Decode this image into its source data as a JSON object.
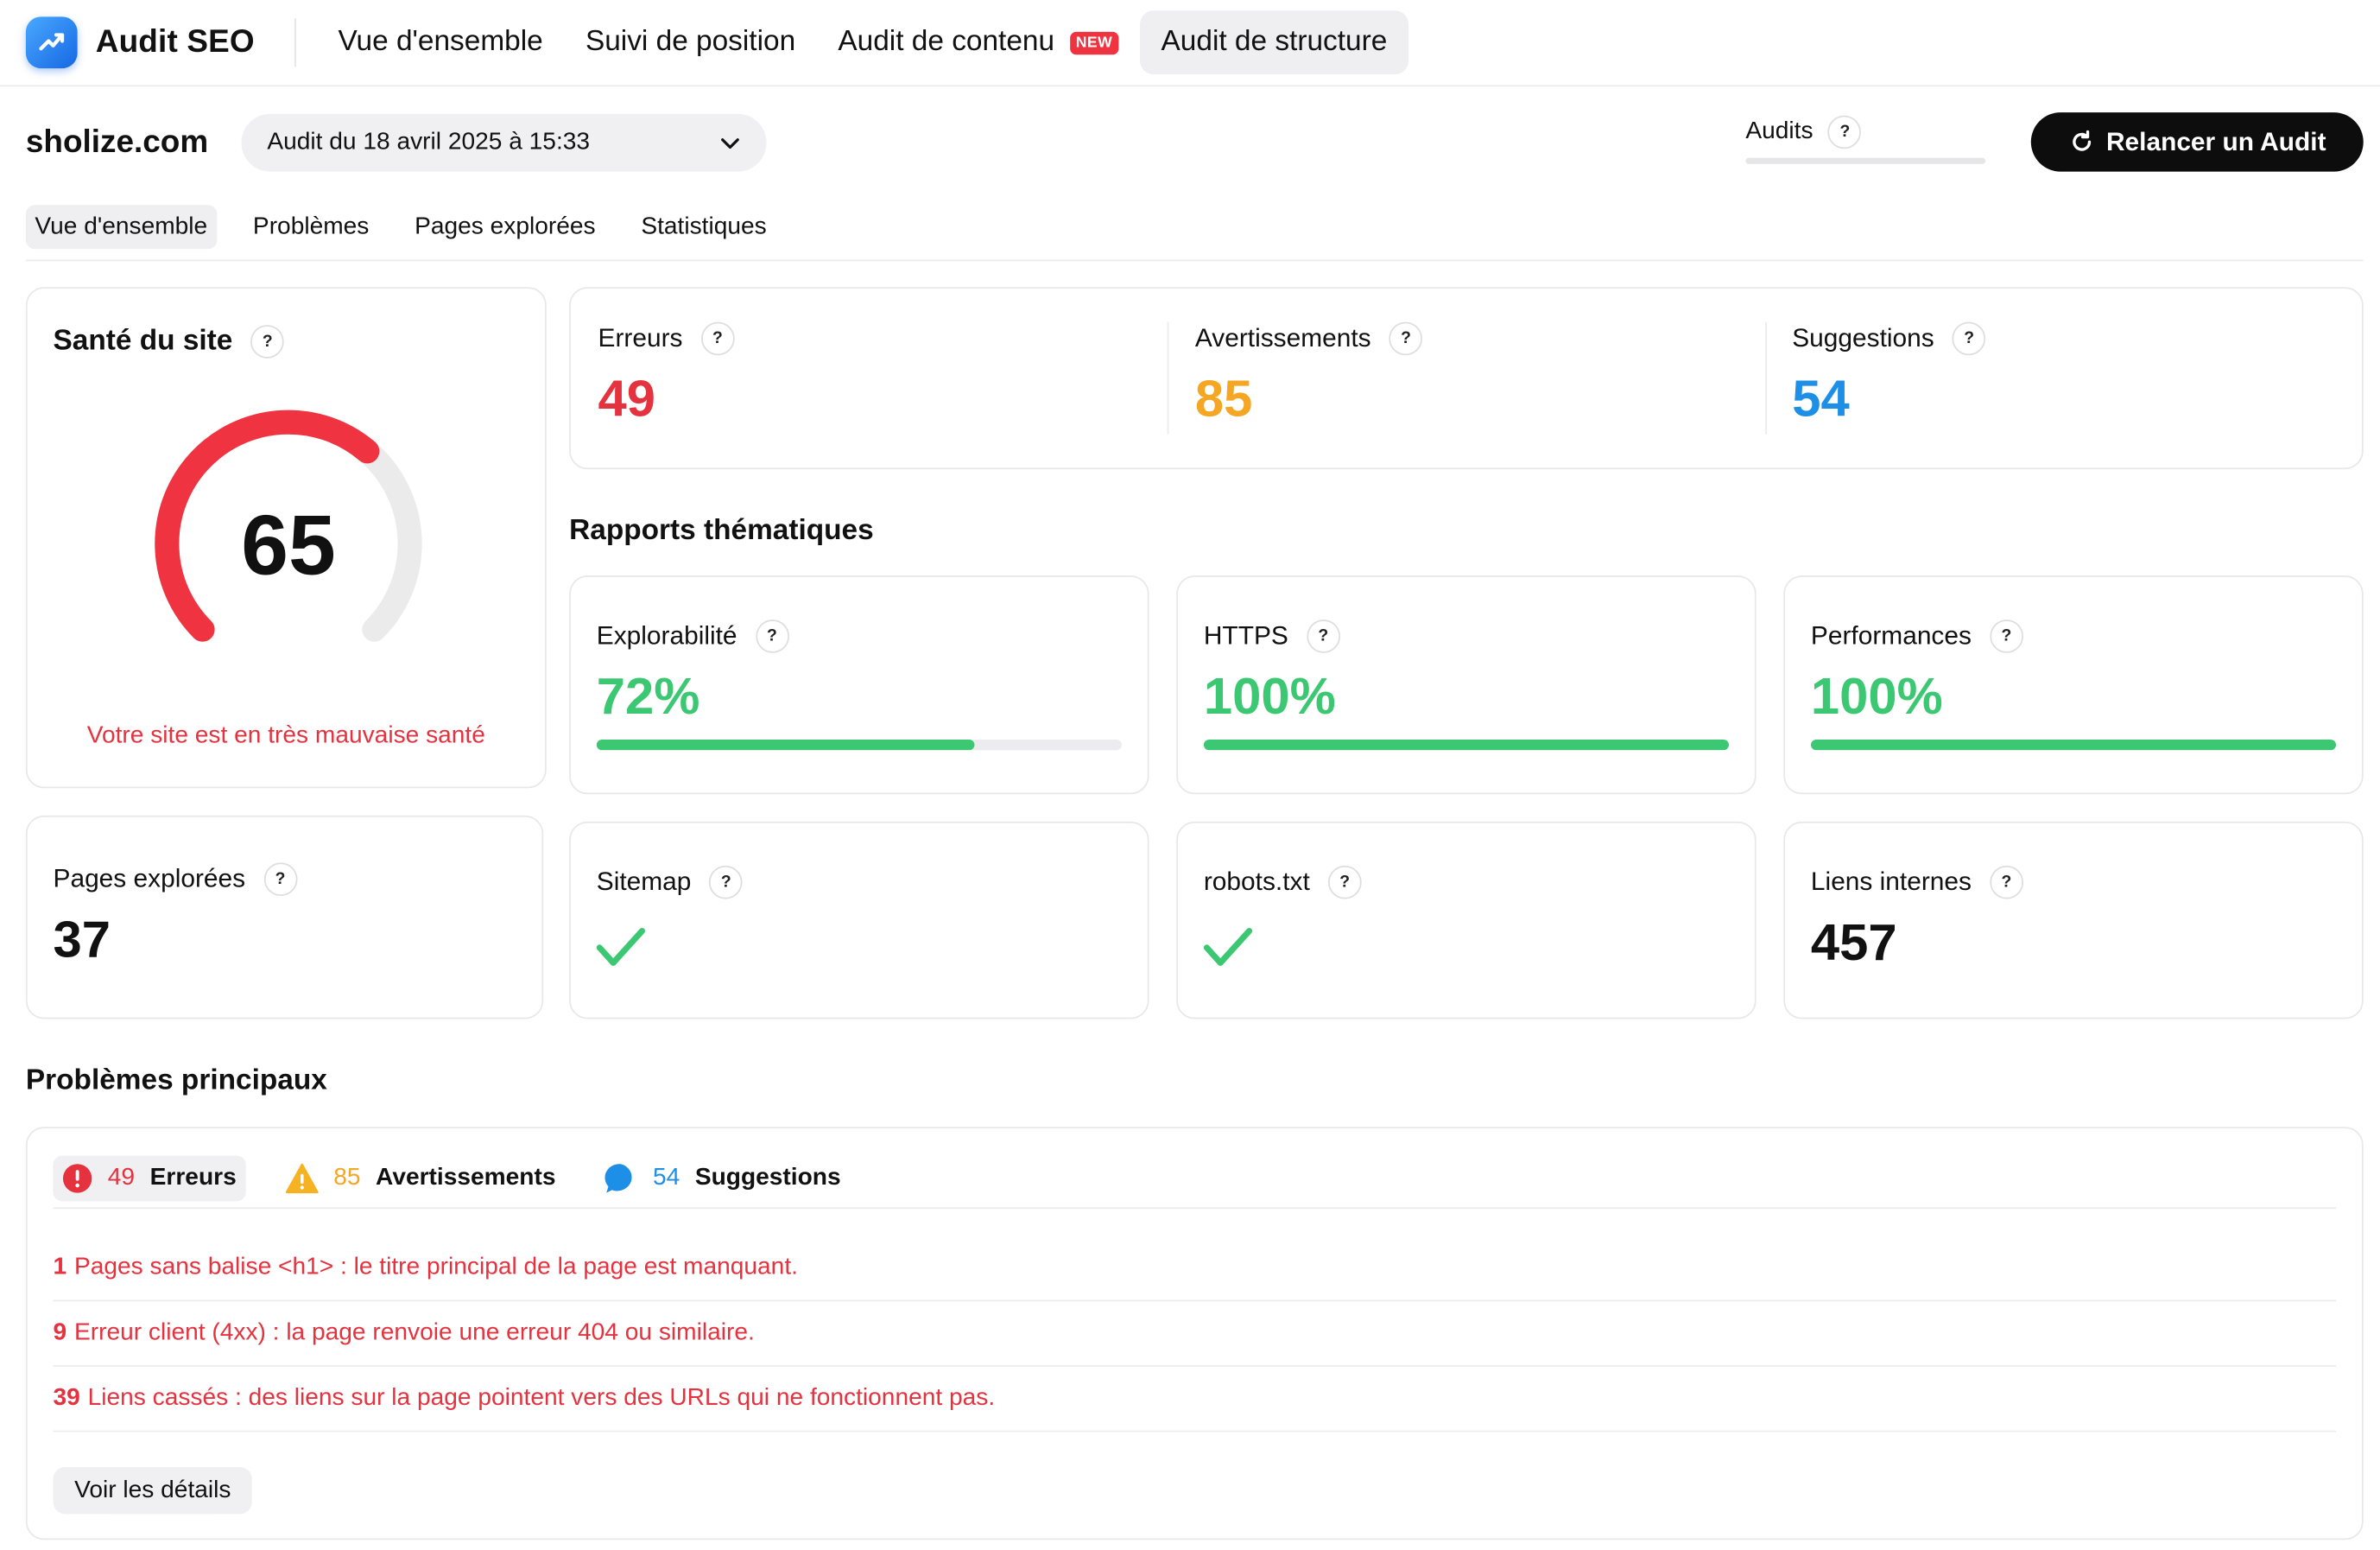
{
  "brand": {
    "name": "Audit SEO",
    "logo_icon": "trend-up-icon"
  },
  "nav": {
    "items": [
      {
        "label": "Vue d'ensemble"
      },
      {
        "label": "Suivi de position"
      },
      {
        "label": "Audit de contenu",
        "badge": "NEW"
      },
      {
        "label": "Audit de structure"
      }
    ]
  },
  "header": {
    "site": "sholize.com",
    "audit_select": "Audit du 18 avril 2025 à 15:33",
    "audits_label": "Audits",
    "relaunch_label": "Relancer un Audit"
  },
  "tabs": [
    {
      "label": "Vue d'ensemble"
    },
    {
      "label": "Problèmes"
    },
    {
      "label": "Pages explorées"
    },
    {
      "label": "Statistiques"
    }
  ],
  "help_mark": "?",
  "health": {
    "title": "Santé du site",
    "score": "65",
    "score_fraction": 0.65,
    "status": "Votre site est en très mauvaise santé"
  },
  "stats": {
    "errors": {
      "label": "Erreurs",
      "value": "49"
    },
    "warnings": {
      "label": "Avertissements",
      "value": "85"
    },
    "suggestions": {
      "label": "Suggestions",
      "value": "54"
    }
  },
  "thematic": {
    "title": "Rapports thématiques",
    "items": [
      {
        "label": "Explorabilité",
        "value": "72%",
        "fraction": 0.72
      },
      {
        "label": "HTTPS",
        "value": "100%",
        "fraction": 1.0
      },
      {
        "label": "Performances",
        "value": "100%",
        "fraction": 1.0
      }
    ]
  },
  "pages_explored": {
    "label": "Pages explorées",
    "value": "37"
  },
  "sitemap": {
    "label": "Sitemap",
    "status_icon": "check-icon"
  },
  "robots": {
    "label": "robots.txt",
    "status_icon": "check-icon"
  },
  "internal_links": {
    "label": "Liens internes",
    "value": "457"
  },
  "problems": {
    "title": "Problèmes principaux",
    "tabs": [
      {
        "count": "49",
        "label": "Erreurs",
        "icon": "error-icon"
      },
      {
        "count": "85",
        "label": "Avertissements",
        "icon": "warning-icon"
      },
      {
        "count": "54",
        "label": "Suggestions",
        "icon": "chat-bubble-icon"
      }
    ],
    "issues": [
      {
        "count": "1",
        "text": "Pages sans balise <h1> : le titre principal de la page est manquant."
      },
      {
        "count": "9",
        "text": "Erreur client (4xx) : la page renvoie une erreur 404 ou similaire."
      },
      {
        "count": "39",
        "text": "Liens cassés : des liens sur la page pointent vers des URLs qui ne fonctionnent pas."
      }
    ],
    "details_label": "Voir les détails"
  },
  "colors": {
    "error": "#e5323f",
    "warning": "#f5a623",
    "suggestion": "#1e8fe6",
    "success": "#3cc872",
    "gauge_track": "#ebebeb"
  }
}
